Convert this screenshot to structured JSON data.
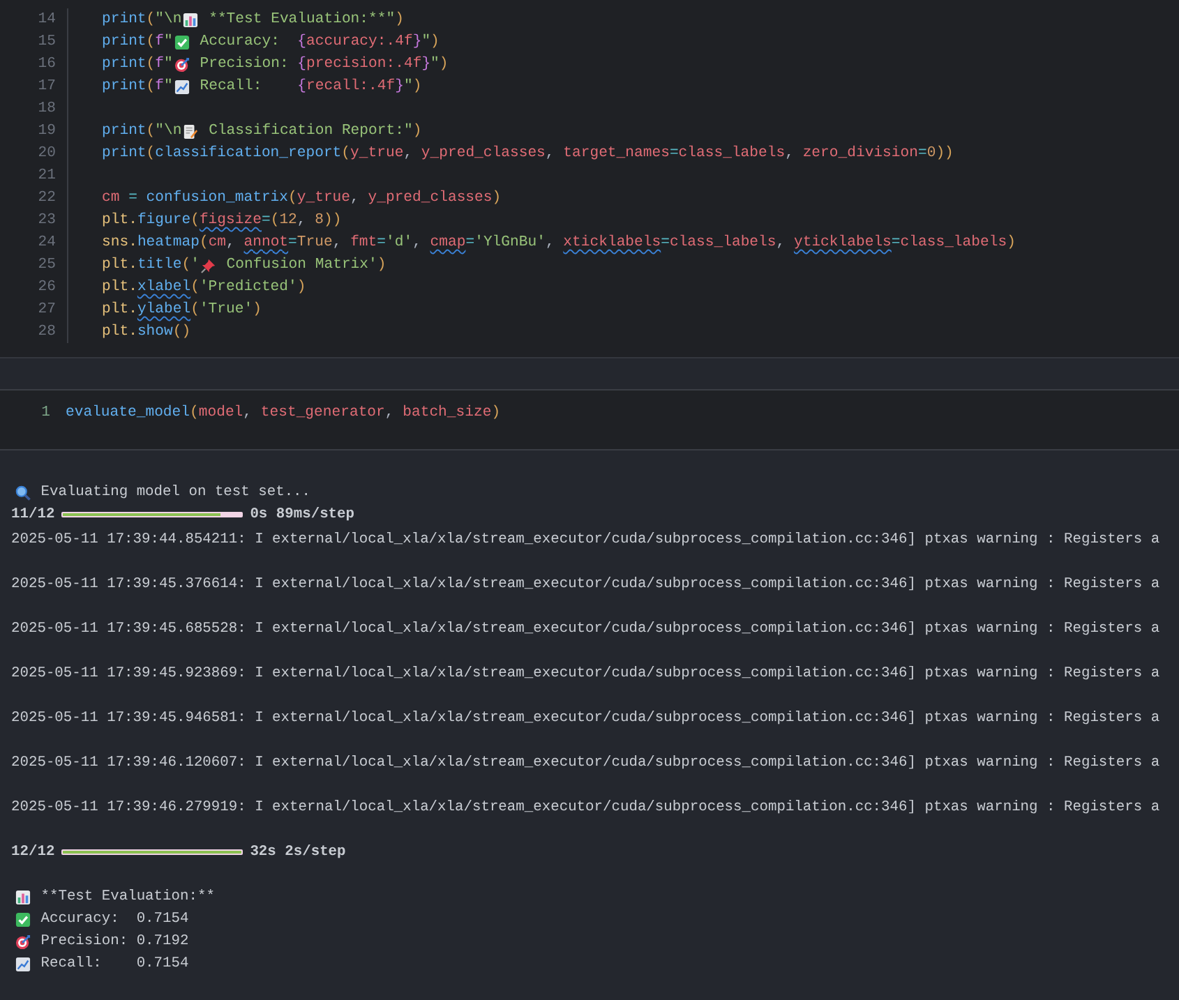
{
  "code_cell": {
    "lines": [
      {
        "number": "14",
        "tokens": [
          {
            "kind": "fn",
            "text": "print"
          },
          {
            "kind": "paren",
            "text": "("
          },
          {
            "kind": "str",
            "text": "\"\\n"
          },
          {
            "kind": "barchart"
          },
          {
            "kind": "str",
            "text": " **Test Evaluation:**\""
          },
          {
            "kind": "paren",
            "text": ")"
          }
        ]
      },
      {
        "number": "15",
        "tokens": [
          {
            "kind": "fn",
            "text": "print"
          },
          {
            "kind": "paren",
            "text": "("
          },
          {
            "kind": "fmt",
            "text": "f"
          },
          {
            "kind": "str",
            "text": "\""
          },
          {
            "kind": "check"
          },
          {
            "kind": "str",
            "text": " Accuracy:  "
          },
          {
            "kind": "fmt",
            "text": "{"
          },
          {
            "kind": "var",
            "text": "accuracy:.4f"
          },
          {
            "kind": "fmt",
            "text": "}"
          },
          {
            "kind": "str",
            "text": "\""
          },
          {
            "kind": "paren",
            "text": ")"
          }
        ]
      },
      {
        "number": "16",
        "tokens": [
          {
            "kind": "fn",
            "text": "print"
          },
          {
            "kind": "paren",
            "text": "("
          },
          {
            "kind": "fmt",
            "text": "f"
          },
          {
            "kind": "str",
            "text": "\""
          },
          {
            "kind": "target"
          },
          {
            "kind": "str",
            "text": " Precision: "
          },
          {
            "kind": "fmt",
            "text": "{"
          },
          {
            "kind": "var",
            "text": "precision:.4f"
          },
          {
            "kind": "fmt",
            "text": "}"
          },
          {
            "kind": "str",
            "text": "\""
          },
          {
            "kind": "paren",
            "text": ")"
          }
        ]
      },
      {
        "number": "17",
        "tokens": [
          {
            "kind": "fn",
            "text": "print"
          },
          {
            "kind": "paren",
            "text": "("
          },
          {
            "kind": "fmt",
            "text": "f"
          },
          {
            "kind": "str",
            "text": "\""
          },
          {
            "kind": "trend"
          },
          {
            "kind": "str",
            "text": " Recall:    "
          },
          {
            "kind": "fmt",
            "text": "{"
          },
          {
            "kind": "var",
            "text": "recall:.4f"
          },
          {
            "kind": "fmt",
            "text": "}"
          },
          {
            "kind": "str",
            "text": "\""
          },
          {
            "kind": "paren",
            "text": ")"
          }
        ]
      },
      {
        "number": "18"
      },
      {
        "number": "19",
        "tokens": [
          {
            "kind": "fn",
            "text": "print"
          },
          {
            "kind": "paren",
            "text": "("
          },
          {
            "kind": "str",
            "text": "\"\\n"
          },
          {
            "kind": "memo"
          },
          {
            "kind": "str",
            "text": " Classification Report:\""
          },
          {
            "kind": "paren",
            "text": ")"
          }
        ]
      },
      {
        "number": "20",
        "tokens": [
          {
            "kind": "fn",
            "text": "print"
          },
          {
            "kind": "paren",
            "text": "("
          },
          {
            "kind": "fn",
            "text": "classification_report"
          },
          {
            "kind": "paren",
            "text": "("
          },
          {
            "kind": "var",
            "text": "y_true"
          },
          {
            "kind": "punct",
            "text": ", "
          },
          {
            "kind": "var",
            "text": "y_pred_classes"
          },
          {
            "kind": "punct",
            "text": ", "
          },
          {
            "kind": "var",
            "text": "target_names"
          },
          {
            "kind": "op",
            "text": "="
          },
          {
            "kind": "var",
            "text": "class_labels"
          },
          {
            "kind": "punct",
            "text": ", "
          },
          {
            "kind": "var",
            "text": "zero_division"
          },
          {
            "kind": "op",
            "text": "="
          },
          {
            "kind": "num",
            "text": "0"
          },
          {
            "kind": "paren",
            "text": "))"
          }
        ]
      },
      {
        "number": "21"
      },
      {
        "number": "22",
        "tokens": [
          {
            "kind": "var",
            "text": "cm"
          },
          {
            "kind": "op",
            "text": " = "
          },
          {
            "kind": "fn",
            "text": "confusion_matrix"
          },
          {
            "kind": "paren",
            "text": "("
          },
          {
            "kind": "var",
            "text": "y_true"
          },
          {
            "kind": "punct",
            "text": ", "
          },
          {
            "kind": "var",
            "text": "y_pred_classes"
          },
          {
            "kind": "paren",
            "text": ")"
          }
        ]
      },
      {
        "number": "23",
        "tokens": [
          {
            "kind": "obj",
            "text": "plt."
          },
          {
            "kind": "fn",
            "text": "figure"
          },
          {
            "kind": "paren",
            "text": "("
          },
          {
            "kind": "var",
            "text": "figsize",
            "squiggle": true
          },
          {
            "kind": "op",
            "text": "="
          },
          {
            "kind": "paren",
            "text": "("
          },
          {
            "kind": "num",
            "text": "12"
          },
          {
            "kind": "punct",
            "text": ", "
          },
          {
            "kind": "num",
            "text": "8"
          },
          {
            "kind": "paren",
            "text": "))"
          }
        ]
      },
      {
        "number": "24",
        "tokens": [
          {
            "kind": "obj",
            "text": "sns."
          },
          {
            "kind": "fn",
            "text": "heatmap"
          },
          {
            "kind": "paren",
            "text": "("
          },
          {
            "kind": "var",
            "text": "cm"
          },
          {
            "kind": "punct",
            "text": ", "
          },
          {
            "kind": "var",
            "text": "annot",
            "squiggle": true
          },
          {
            "kind": "op",
            "text": "="
          },
          {
            "kind": "num",
            "text": "True"
          },
          {
            "kind": "punct",
            "text": ", "
          },
          {
            "kind": "var",
            "text": "fmt"
          },
          {
            "kind": "op",
            "text": "="
          },
          {
            "kind": "str",
            "text": "'d'"
          },
          {
            "kind": "punct",
            "text": ", "
          },
          {
            "kind": "var",
            "text": "cmap",
            "squiggle": true
          },
          {
            "kind": "op",
            "text": "="
          },
          {
            "kind": "str",
            "text": "'YlGnBu'"
          },
          {
            "kind": "punct",
            "text": ", "
          },
          {
            "kind": "var",
            "text": "xticklabels",
            "squiggle": true
          },
          {
            "kind": "op",
            "text": "="
          },
          {
            "kind": "var",
            "text": "class_labels"
          },
          {
            "kind": "punct",
            "text": ", "
          },
          {
            "kind": "var",
            "text": "yticklabels",
            "squiggle": true
          },
          {
            "kind": "op",
            "text": "="
          },
          {
            "kind": "var",
            "text": "class_labels"
          },
          {
            "kind": "paren",
            "text": ")"
          }
        ]
      },
      {
        "number": "25",
        "tokens": [
          {
            "kind": "obj",
            "text": "plt."
          },
          {
            "kind": "fn",
            "text": "title"
          },
          {
            "kind": "paren",
            "text": "("
          },
          {
            "kind": "str",
            "text": "'"
          },
          {
            "kind": "pin"
          },
          {
            "kind": "str",
            "text": " Confusion Matrix'"
          },
          {
            "kind": "paren",
            "text": ")"
          }
        ]
      },
      {
        "number": "26",
        "tokens": [
          {
            "kind": "obj",
            "text": "plt."
          },
          {
            "kind": "fn",
            "text": "xlabel",
            "squiggle": true
          },
          {
            "kind": "paren",
            "text": "("
          },
          {
            "kind": "str",
            "text": "'Predicted'"
          },
          {
            "kind": "paren",
            "text": ")"
          }
        ]
      },
      {
        "number": "27",
        "tokens": [
          {
            "kind": "obj",
            "text": "plt."
          },
          {
            "kind": "fn",
            "text": "ylabel",
            "squiggle": true
          },
          {
            "kind": "paren",
            "text": "("
          },
          {
            "kind": "str",
            "text": "'True'"
          },
          {
            "kind": "paren",
            "text": ")"
          }
        ]
      },
      {
        "number": "28",
        "tokens": [
          {
            "kind": "obj",
            "text": "plt."
          },
          {
            "kind": "fn",
            "text": "show"
          },
          {
            "kind": "paren",
            "text": "()"
          }
        ]
      }
    ]
  },
  "run_cell": {
    "lines": [
      {
        "number": "1",
        "tokens": [
          {
            "kind": "fn",
            "text": "evaluate_model"
          },
          {
            "kind": "paren",
            "text": "("
          },
          {
            "kind": "var",
            "text": "model"
          },
          {
            "kind": "punct",
            "text": ", "
          },
          {
            "kind": "var",
            "text": "test_generator"
          },
          {
            "kind": "punct",
            "text": ", "
          },
          {
            "kind": "var",
            "text": "batch_size"
          },
          {
            "kind": "paren",
            "text": ")"
          }
        ]
      }
    ]
  },
  "output": [
    {
      "kind": "status",
      "tokens": [
        {
          "kind": "search"
        },
        {
          "kind": "out",
          "text": " Evaluating model on test set..."
        }
      ]
    },
    {
      "kind": "progress",
      "count": "11/12",
      "level": 0.88,
      "timing": "0s 89ms/step"
    },
    {
      "kind": "log",
      "text": "2025-05-11 17:39:44.854211: I external/local_xla/xla/stream_executor/cuda/subprocess_compilation.cc:346] ptxas warning : Registers a"
    },
    {
      "kind": "log",
      "text": "2025-05-11 17:39:45.376614: I external/local_xla/xla/stream_executor/cuda/subprocess_compilation.cc:346] ptxas warning : Registers a"
    },
    {
      "kind": "log",
      "text": "2025-05-11 17:39:45.685528: I external/local_xla/xla/stream_executor/cuda/subprocess_compilation.cc:346] ptxas warning : Registers a"
    },
    {
      "kind": "log",
      "text": "2025-05-11 17:39:45.923869: I external/local_xla/xla/stream_executor/cuda/subprocess_compilation.cc:346] ptxas warning : Registers a"
    },
    {
      "kind": "log",
      "text": "2025-05-11 17:39:45.946581: I external/local_xla/xla/stream_executor/cuda/subprocess_compilation.cc:346] ptxas warning : Registers a"
    },
    {
      "kind": "log",
      "text": "2025-05-11 17:39:46.120607: I external/local_xla/xla/stream_executor/cuda/subprocess_compilation.cc:346] ptxas warning : Registers a"
    },
    {
      "kind": "log",
      "text": "2025-05-11 17:39:46.279919: I external/local_xla/xla/stream_executor/cuda/subprocess_compilation.cc:346] ptxas warning : Registers a"
    },
    {
      "kind": "progress",
      "count": "12/12",
      "level": 1,
      "timing": "32s 2s/step"
    },
    {
      "kind": "result",
      "tokens": [
        {
          "kind": "barchart"
        },
        {
          "kind": "out",
          "text": " **Test Evaluation:**"
        }
      ]
    },
    {
      "kind": "result",
      "tokens": [
        {
          "kind": "check"
        },
        {
          "kind": "out",
          "text": " Accuracy:  0.7154"
        }
      ]
    },
    {
      "kind": "result",
      "tokens": [
        {
          "kind": "target"
        },
        {
          "kind": "out",
          "text": " Precision: 0.7192"
        }
      ]
    },
    {
      "kind": "result",
      "tokens": [
        {
          "kind": "trend"
        },
        {
          "kind": "out",
          "text": " Recall:    0.7154"
        }
      ]
    }
  ]
}
